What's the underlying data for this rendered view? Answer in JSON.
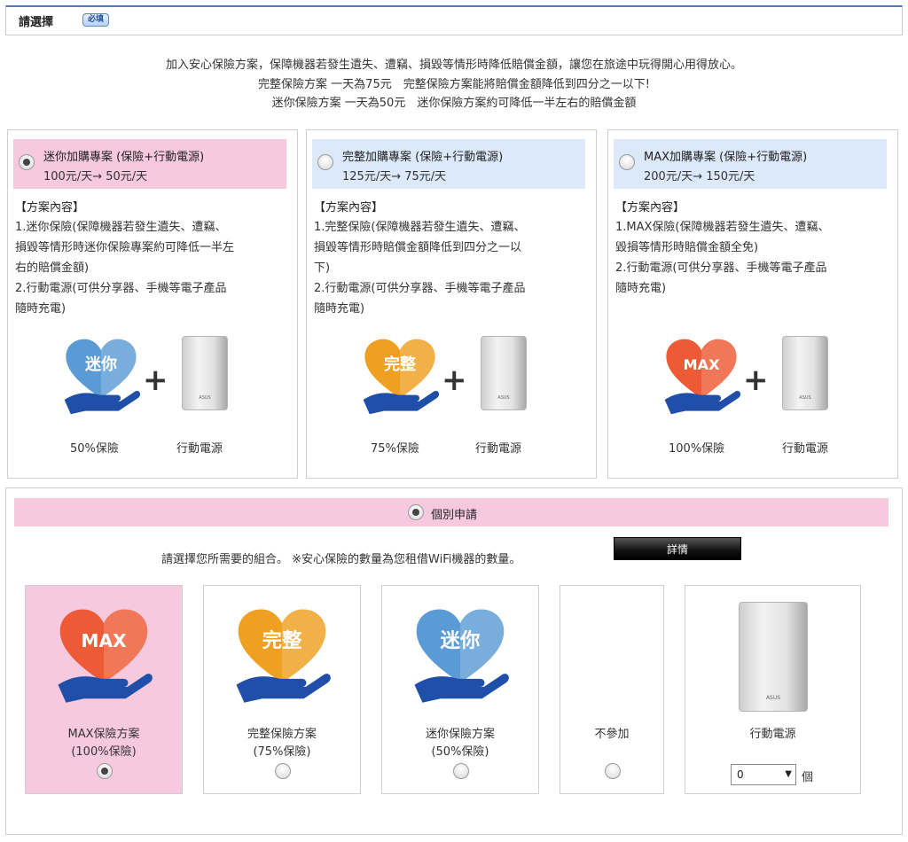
{
  "header": {
    "title": "請選擇",
    "required_badge": "必填"
  },
  "intro": {
    "line1": "加入安心保險方案，保障機器若發生遺失、遭竊、損毀等情形時降低賠償金額，讓您在旅途中玩得開心用得放心。",
    "line2": "完整保險方案 一天為75元　完整保險方案能將賠償金額降低到四分之一以下!",
    "line3": "迷你保險方案 一天為50元　迷你保險方案約可降低一半左右的賠償金額"
  },
  "plans": [
    {
      "name": "迷你加購專案 (保險+行動電源)",
      "price": "100元/天→ 50元/天",
      "content_title": "【方案內容】",
      "content_lines": [
        "1.迷你保險(保障機器若發生遺失、遭竊、",
        "損毀等情形時迷你保險專案約可降低一半左",
        "右的賠償金額)",
        "2.行動電源(可供分享器、手機等電子產品",
        "隨時充電)"
      ],
      "heart_text": "迷你",
      "heart_color": "#5b9bd5",
      "insurance_caption": "50%保險",
      "powerbank_caption": "行動電源",
      "powerbank_logo": "ASUS",
      "selected": true
    },
    {
      "name": "完整加購專案 (保險+行動電源)",
      "price": "125元/天→ 75元/天",
      "content_title": "【方案內容】",
      "content_lines": [
        "1.完整保險(保障機器若發生遺失、遭竊、",
        "損毀等情形時賠償金額降低到四分之一以",
        "下)",
        "2.行動電源(可供分享器、手機等電子產品",
        "隨時充電)"
      ],
      "heart_text": "完整",
      "heart_color": "#f0a020",
      "insurance_caption": "75%保險",
      "powerbank_caption": "行動電源",
      "powerbank_logo": "ASUS",
      "selected": false
    },
    {
      "name": "MAX加購專案 (保險+行動電源)",
      "price": "200元/天→ 150元/天",
      "content_title": "【方案內容】",
      "content_lines": [
        "1.MAX保險(保障機器若發生遺失、遭竊、",
        "毀損等情形時賠償金額全免)",
        "2.行動電源(可供分享器、手機等電子產品",
        "隨時充電)"
      ],
      "heart_text": "MAX",
      "heart_color": "#ee5a35",
      "insurance_caption": "100%保險",
      "powerbank_caption": "行動電源",
      "powerbank_logo": "ASUS",
      "selected": false
    }
  ],
  "individual": {
    "label": "個別申請",
    "choose_text": "請選擇您所需要的組合。 ※安心保險的數量為您租借WiFi機器的數量。",
    "detail_button": "詳情",
    "options": [
      {
        "heart_text": "MAX",
        "heart_color": "#ee5a35",
        "line1": "MAX保險方案",
        "line2": "(100%保險)",
        "selected": true
      },
      {
        "heart_text": "完整",
        "heart_color": "#f0a020",
        "line1": "完整保險方案",
        "line2": "(75%保險)",
        "selected": false
      },
      {
        "heart_text": "迷你",
        "heart_color": "#5b9bd5",
        "line1": "迷你保險方案",
        "line2": "(50%保險)",
        "selected": false
      },
      {
        "line1": "不參加",
        "selected": false
      }
    ],
    "powerbank": {
      "label": "行動電源",
      "logo": "ASUS",
      "quantity": "0",
      "unit": "個"
    }
  },
  "colors": {
    "pink_bg": "#f7c9de",
    "blue_bg": "#dbe9fb",
    "hand": "#1f4fa8"
  }
}
